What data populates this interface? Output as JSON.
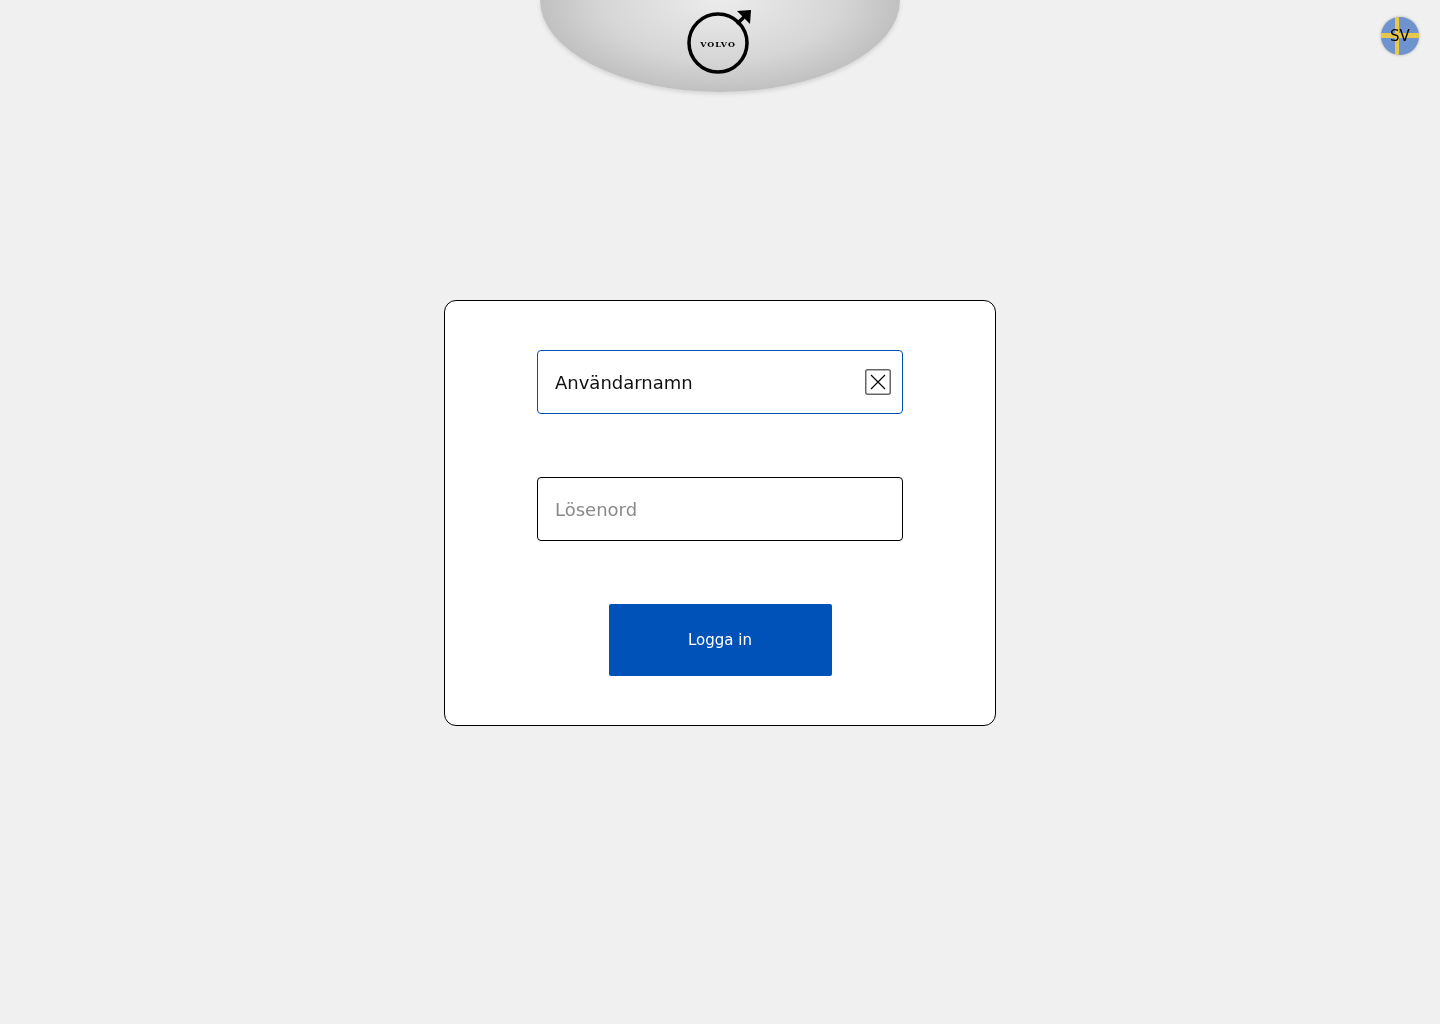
{
  "header": {
    "brand": "VOLVO"
  },
  "language": {
    "code": "SV"
  },
  "form": {
    "username": {
      "value": "Användarnamn",
      "focused": true
    },
    "password": {
      "placeholder": "Lösenord",
      "focused": false
    },
    "submit": "Logga in"
  }
}
